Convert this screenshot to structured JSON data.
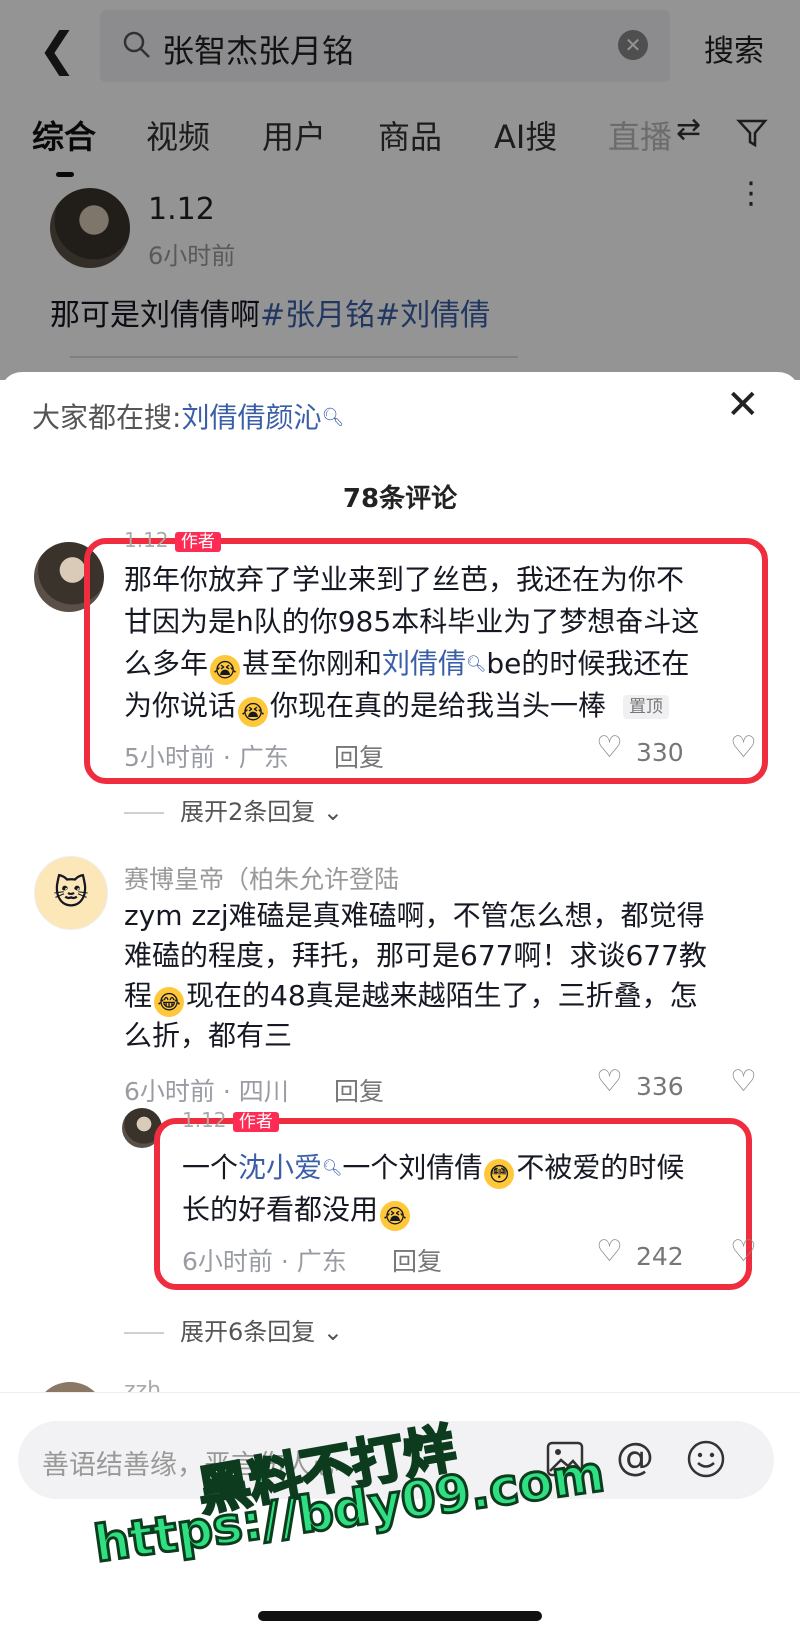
{
  "search": {
    "query": "张智杰张月铭",
    "submit_label": "搜索"
  },
  "tabs": [
    "综合",
    "视频",
    "用户",
    "商品",
    "AI搜",
    "直播"
  ],
  "post": {
    "author": "1.12",
    "time": "6小时前",
    "text_plain": "那可是刘倩倩啊",
    "hashtag1": "#张月铭",
    "hashtag2": "#刘倩倩"
  },
  "sheet": {
    "everyone_searching_label": "大家都在搜:",
    "everyone_searching_term": "刘倩倩颜沁",
    "comment_count": "78条评论"
  },
  "comment1": {
    "author": "1.12",
    "author_tag": "作者",
    "line1": "那年你放弃了学业来到了丝芭，我还在为你不",
    "line2": "甘因为是h队的你985本科毕业为了梦想奋斗这",
    "line3_a": "么多年",
    "line3_b": "甚至你刚和",
    "line3_link": "刘倩倩",
    "line3_c": "be的时候我还在",
    "line4_a": "为你说话",
    "line4_b": "你现在真的是给我当头一棒",
    "pinned": "置顶",
    "meta": "5小时前 · 广东",
    "reply": "回复",
    "likes": "330",
    "expand": "展开2条回复"
  },
  "comment2": {
    "author": "赛博皇帝（柏朱允许登陆",
    "line1": "zym zzj难磕是真难磕啊，不管怎么想，都觉得",
    "line2": "难磕的程度，拜托，那可是677啊！求谈677教",
    "line3_a": "程",
    "line3_b": "现在的48真是越来越陌生了，三折叠，怎",
    "line4": "么折，都有三",
    "meta": "6小时前 · 四川",
    "reply": "回复",
    "likes": "336"
  },
  "reply1": {
    "author": "1.12",
    "author_tag": "作者",
    "a": "一个",
    "link": "沈小爱",
    "b": "一个刘倩倩",
    "c": "不被爱的时候",
    "line2": "长的好看都没用",
    "meta": "6小时前 · 广东",
    "reply": "回复",
    "likes": "242",
    "expand": "展开6条回复"
  },
  "comment3": {
    "author": "zzh"
  },
  "input": {
    "placeholder": "善语结善缘，恶言伤人心"
  },
  "watermark": {
    "line1": "黑料不打烊",
    "line2": "https://bdy09.com"
  },
  "icons": [
    "back-arrow-icon",
    "search-icon",
    "clear-icon",
    "sort-icon",
    "filter-icon",
    "more-icon",
    "close-icon",
    "heart-icon",
    "dislike-icon",
    "image-icon",
    "at-icon",
    "emoji-icon"
  ]
}
